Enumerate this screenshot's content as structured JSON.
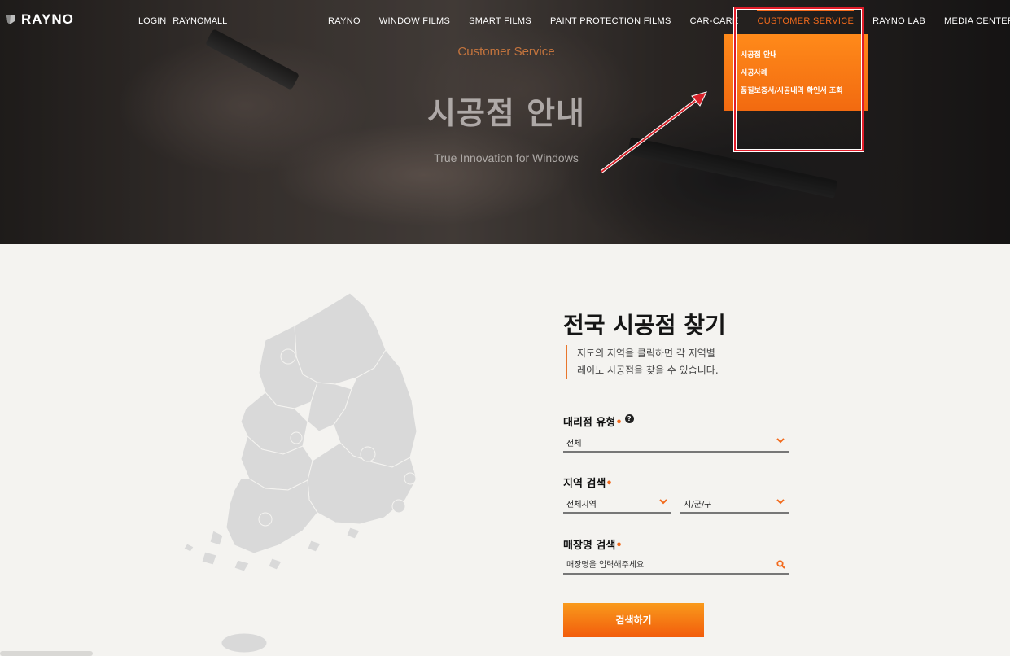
{
  "header": {
    "logo": "RAYNO",
    "util": [
      "LOGIN",
      "RAYNOMALL"
    ],
    "nav": [
      {
        "label": "RAYNO",
        "active": false
      },
      {
        "label": "WINDOW FILMS",
        "active": false
      },
      {
        "label": "SMART FILMS",
        "active": false
      },
      {
        "label": "PAINT PROTECTION FILMS",
        "active": false
      },
      {
        "label": "CAR-CARE",
        "active": false
      },
      {
        "label": "CUSTOMER SERVICE",
        "active": true
      },
      {
        "label": "RAYNO LAB",
        "active": false
      },
      {
        "label": "MEDIA CENTER",
        "active": false
      }
    ],
    "dropdown": [
      "시공점 안내",
      "시공사례",
      "품질보증서/시공내역 확인서 조회"
    ]
  },
  "hero": {
    "subtitle": "Customer Service",
    "title": "시공점 안내",
    "tagline": "True Innovation for Windows"
  },
  "finder": {
    "title": "전국 시공점 찾기",
    "desc_line1": "지도의 지역을 클릭하면 각 지역별",
    "desc_line2": "레이노 시공점을 찾을 수 있습니다.",
    "type_label": "대리점 유형",
    "help": "?",
    "type_value": "전체",
    "region_label": "지역 검색",
    "region_value": "전체지역",
    "city_value": "시/군/구",
    "store_label": "매장명 검색",
    "store_placeholder": "매장명을 입력해주세요",
    "search_button": "검색하기"
  },
  "colors": {
    "accent": "#f26a1c",
    "highlight": "#e11d2a",
    "map_fill": "#d9d9d9"
  }
}
